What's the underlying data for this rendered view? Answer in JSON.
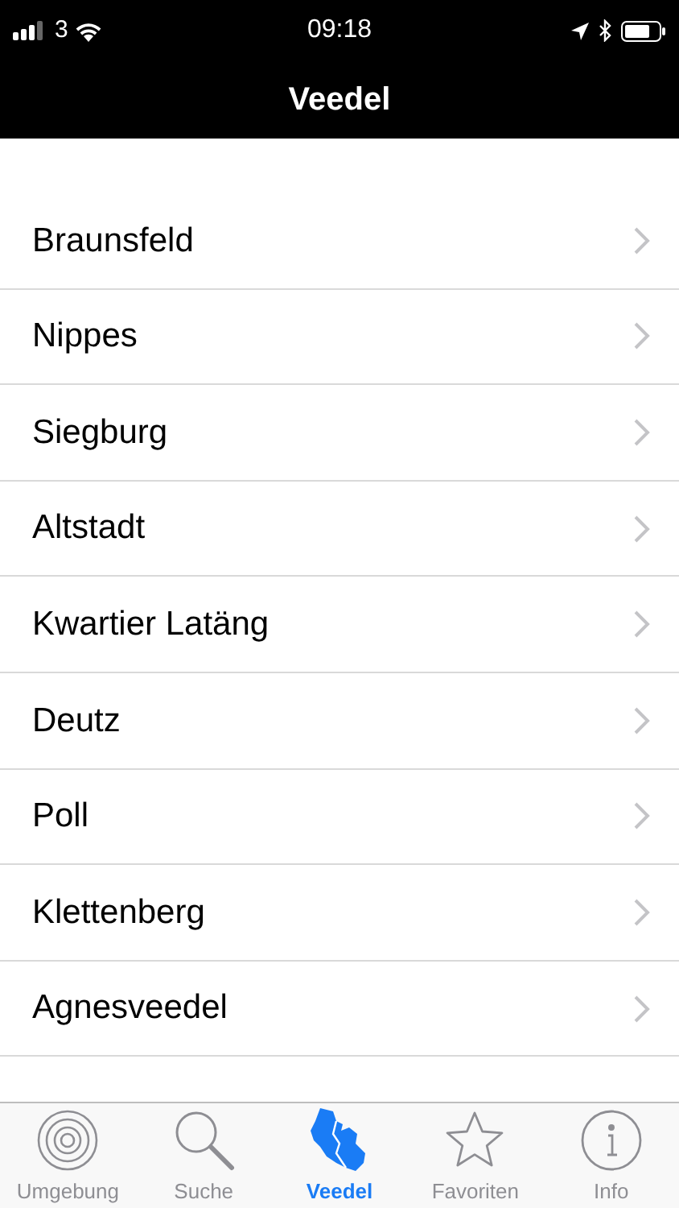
{
  "status_bar": {
    "carrier": "3",
    "time": "09:18"
  },
  "nav_bar": {
    "title": "Veedel"
  },
  "list": [
    {
      "label": "Braunsfeld"
    },
    {
      "label": "Nippes"
    },
    {
      "label": "Siegburg"
    },
    {
      "label": "Altstadt"
    },
    {
      "label": "Kwartier Latäng"
    },
    {
      "label": "Deutz"
    },
    {
      "label": "Poll"
    },
    {
      "label": "Klettenberg"
    },
    {
      "label": "Agnesveedel"
    }
  ],
  "tab_bar": [
    {
      "label": "Umgebung",
      "kind": "radar",
      "selected": false
    },
    {
      "label": "Suche",
      "kind": "search",
      "selected": false
    },
    {
      "label": "Veedel",
      "kind": "map",
      "selected": true
    },
    {
      "label": "Favoriten",
      "kind": "star",
      "selected": false
    },
    {
      "label": "Info",
      "kind": "info",
      "selected": false
    }
  ]
}
